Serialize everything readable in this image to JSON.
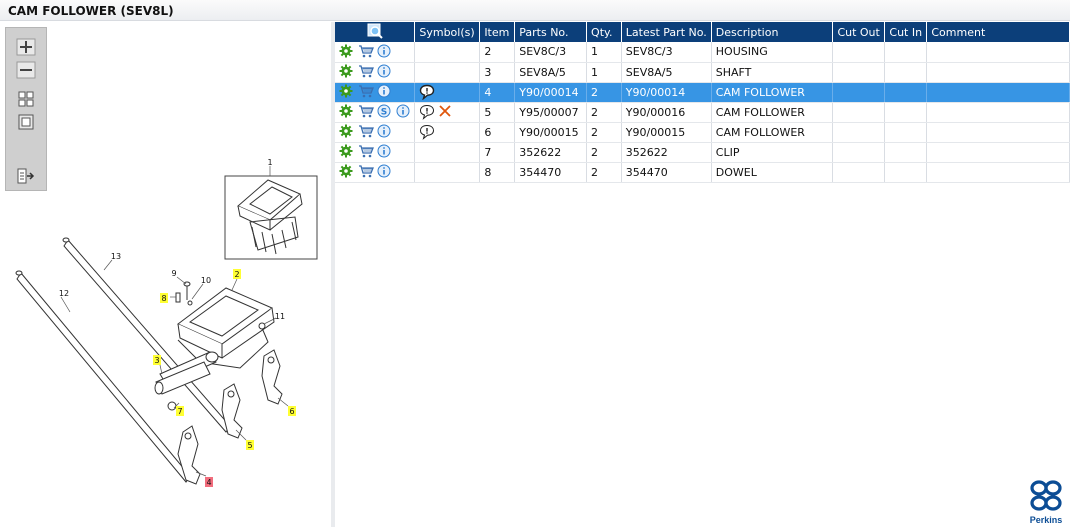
{
  "window": {
    "title": "CAM FOLLOWER (SEV8L)"
  },
  "colors": {
    "header_bg": "#0c3f7a",
    "selected_row": "#3795e4",
    "callout_yellow": "#ffff33",
    "callout_red": "#f26d7d",
    "gear_green": "#3b9a1d",
    "info_blue": "#2f7fd1"
  },
  "toolbox": {
    "buttons": [
      {
        "name": "zoom-in-icon"
      },
      {
        "name": "zoom-out-icon"
      },
      {
        "name": "grid-view-icon"
      },
      {
        "name": "fit-view-icon"
      },
      {
        "name": "export-icon"
      }
    ]
  },
  "diagram": {
    "callouts": [
      {
        "label": "1",
        "style": "plain"
      },
      {
        "label": "2",
        "style": "yellow"
      },
      {
        "label": "3",
        "style": "yellow"
      },
      {
        "label": "4",
        "style": "red"
      },
      {
        "label": "5",
        "style": "yellow"
      },
      {
        "label": "6",
        "style": "yellow"
      },
      {
        "label": "7",
        "style": "yellow"
      },
      {
        "label": "8",
        "style": "yellow"
      },
      {
        "label": "9",
        "style": "plain"
      },
      {
        "label": "10",
        "style": "plain"
      },
      {
        "label": "11",
        "style": "plain"
      },
      {
        "label": "12",
        "style": "plain"
      },
      {
        "label": "13",
        "style": "plain"
      }
    ]
  },
  "table": {
    "headers": {
      "search_icon": "magnifier-icon",
      "symbols": "Symbol(s)",
      "item": "Item",
      "parts_no": "Parts No.",
      "qty": "Qty.",
      "latest": "Latest Part No.",
      "description": "Description",
      "cut_out": "Cut Out",
      "cut_in": "Cut In",
      "comment": "Comment"
    },
    "rows": [
      {
        "item": "2",
        "parts_no": "SEV8C/3",
        "qty": "1",
        "latest": "SEV8C/3",
        "description": "HOUSING",
        "cut_out": "",
        "cut_in": "",
        "comment": "",
        "service": false,
        "symbol": "",
        "remove": false,
        "selected": false
      },
      {
        "item": "3",
        "parts_no": "SEV8A/5",
        "qty": "1",
        "latest": "SEV8A/5",
        "description": "SHAFT",
        "cut_out": "",
        "cut_in": "",
        "comment": "",
        "service": false,
        "symbol": "",
        "remove": false,
        "selected": false
      },
      {
        "item": "4",
        "parts_no": "Y90/00014",
        "qty": "2",
        "latest": "Y90/00014",
        "description": "CAM FOLLOWER",
        "cut_out": "",
        "cut_in": "",
        "comment": "",
        "service": false,
        "symbol": "note-bold",
        "remove": false,
        "selected": true
      },
      {
        "item": "5",
        "parts_no": "Y95/00007",
        "qty": "2",
        "latest": "Y90/00016",
        "description": "CAM FOLLOWER",
        "cut_out": "",
        "cut_in": "",
        "comment": "",
        "service": true,
        "symbol": "note",
        "remove": true,
        "selected": false
      },
      {
        "item": "6",
        "parts_no": "Y90/00015",
        "qty": "2",
        "latest": "Y90/00015",
        "description": "CAM FOLLOWER",
        "cut_out": "",
        "cut_in": "",
        "comment": "",
        "service": false,
        "symbol": "note",
        "remove": false,
        "selected": false
      },
      {
        "item": "7",
        "parts_no": "352622",
        "qty": "2",
        "latest": "352622",
        "description": "CLIP",
        "cut_out": "",
        "cut_in": "",
        "comment": "",
        "service": false,
        "symbol": "",
        "remove": false,
        "selected": false
      },
      {
        "item": "8",
        "parts_no": "354470",
        "qty": "2",
        "latest": "354470",
        "description": "DOWEL",
        "cut_out": "",
        "cut_in": "",
        "comment": "",
        "service": false,
        "symbol": "",
        "remove": false,
        "selected": false
      }
    ]
  },
  "branding": {
    "logo_text": "Perkins"
  }
}
